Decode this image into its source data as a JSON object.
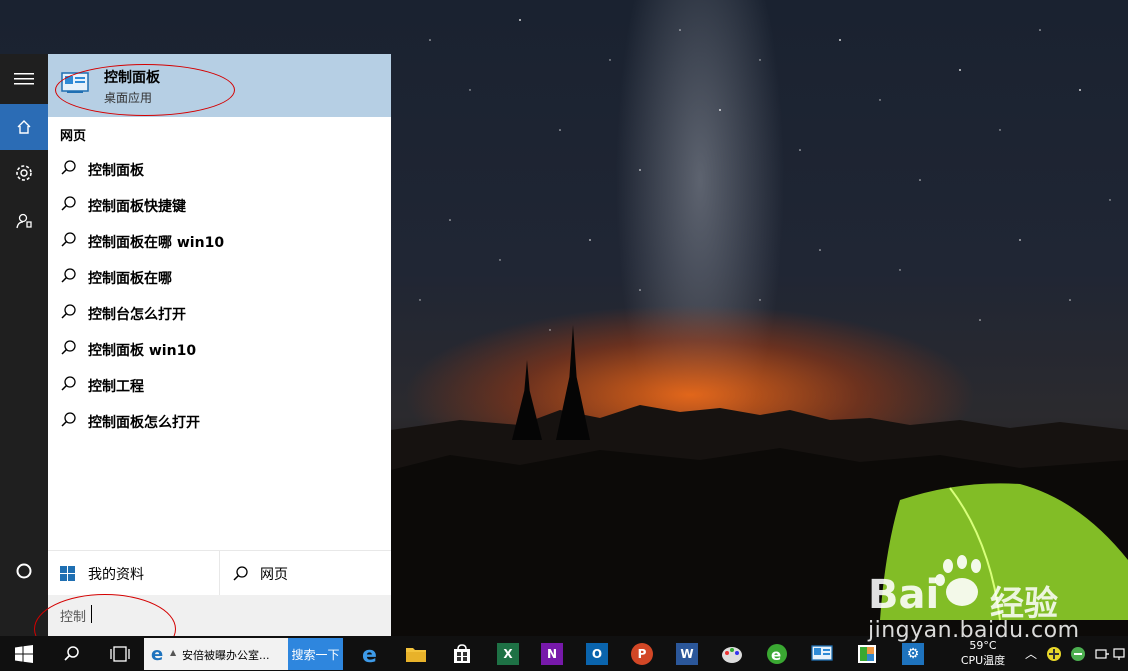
{
  "best_match": {
    "title": "控制面板",
    "subtitle": "桌面应用"
  },
  "web_section": "网页",
  "suggestions": [
    "控制面板",
    "控制面板快捷键",
    "控制面板在哪 win10",
    "控制面板在哪",
    "控制台怎么打开",
    "控制面板 win10",
    "控制工程",
    "控制面板怎么打开"
  ],
  "bottom": {
    "my_stuff": "我的资料",
    "web": "网页"
  },
  "search": {
    "value": "控制"
  },
  "taskbar": {
    "ie_title": "安倍被曝办公室...",
    "search_button": "搜索一下",
    "temp_value": "59°C",
    "temp_label": "CPU温度"
  },
  "watermark": {
    "brand": "Bai  经验",
    "url": "jingyan.baidu.com"
  },
  "colors": {
    "accent": "#2b6cb5",
    "best_match_bg": "#b6cfe4",
    "annotation": "#d40000"
  }
}
